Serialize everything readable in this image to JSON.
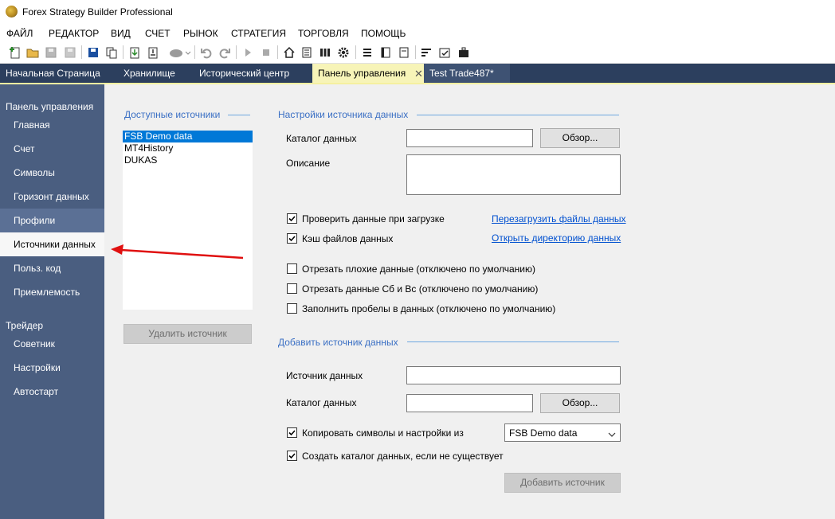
{
  "window": {
    "title": "Forex Strategy Builder Professional"
  },
  "menu": [
    "ФАЙЛ",
    "РЕДАКТОР",
    "ВИД",
    "СЧЕТ",
    "РЫНОК",
    "СТРАТЕГИЯ",
    "ТОРГОВЛЯ",
    "ПОМОЩЬ"
  ],
  "tabs": [
    {
      "label": "Начальная Страница"
    },
    {
      "label": "Хранилище"
    },
    {
      "label": "Исторический центр"
    },
    {
      "label": "Панель управления",
      "close": "✕"
    },
    {
      "label": "Test Trade487*"
    }
  ],
  "sidebar": {
    "group1": "Панель управления",
    "items1": [
      "Главная",
      "Счет",
      "Символы",
      "Горизонт данных",
      "Профили",
      "Источники данных",
      "Польз. код",
      "Приемлемость"
    ],
    "group2": "Трейдер",
    "items2": [
      "Советник",
      "Настройки",
      "Автостарт"
    ]
  },
  "sources": {
    "title": "Доступные источники",
    "items": [
      "FSB Demo data",
      "MT4History",
      "DUKAS"
    ],
    "delete_button": "Удалить источник"
  },
  "settings": {
    "title": "Настройки источника данных",
    "catalog_label": "Каталог данных",
    "catalog_value": "",
    "browse_button": "Обзор...",
    "description_label": "Описание",
    "description_value": "",
    "check_on_load": {
      "label": "Проверить данные при загрузке",
      "checked": true
    },
    "cache_files": {
      "label": "Кэш файлов данных",
      "checked": true
    },
    "reload_link": "Перезагрузить файлы данных",
    "open_dir_link": "Открыть директорию данных",
    "cut_bad": {
      "label": "Отрезать плохие данные (отключено по умолчанию)",
      "checked": false
    },
    "cut_weekend": {
      "label": "Отрезать данные Сб и Вс (отключено по умолчанию)",
      "checked": false
    },
    "fill_gaps": {
      "label": "Заполнить пробелы в данных (отключено по умолчанию)",
      "checked": false
    }
  },
  "add_source": {
    "title": "Добавить источник данных",
    "source_label": "Источник данных",
    "source_value": "",
    "catalog_label": "Каталог данных",
    "catalog_value": "",
    "browse_button": "Обзор...",
    "copy_symbols": {
      "label": "Копировать символы и настройки из",
      "checked": true
    },
    "copy_from_value": "FSB Demo data",
    "create_dir": {
      "label": "Создать каталог данных, если не существует",
      "checked": true
    },
    "add_button": "Добавить источник"
  },
  "colors": {
    "tabbar": "#2c3f5e",
    "sidebar": "#4a5e80",
    "active_tab": "#f7f4b8",
    "selection": "#0078d7",
    "section_title": "#3a6fc4",
    "annotation_arrow": "#e01010"
  }
}
